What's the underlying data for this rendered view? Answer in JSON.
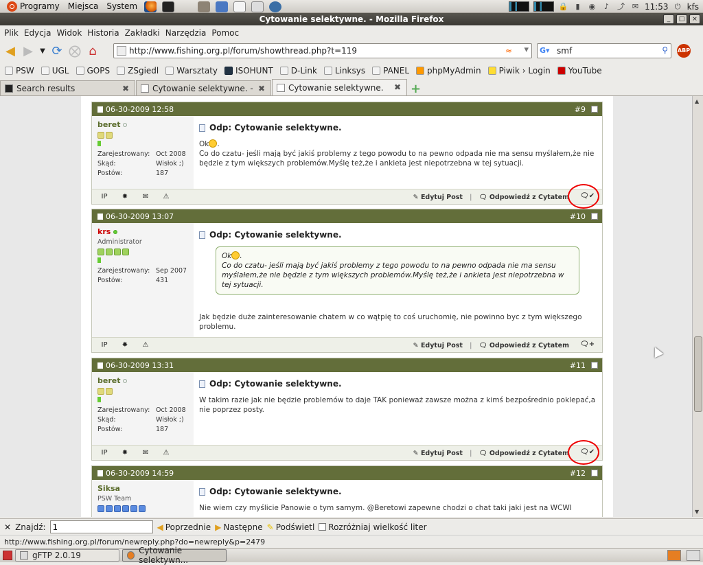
{
  "gnome_top": {
    "menus": [
      "Programy",
      "Miejsca",
      "System"
    ],
    "clock": "11:53",
    "user": "kfs"
  },
  "window": {
    "title": "Cytowanie selektywne. - Mozilla Firefox"
  },
  "menubar": [
    "Plik",
    "Edycja",
    "Widok",
    "Historia",
    "Zakładki",
    "Narzędzia",
    "Pomoc"
  ],
  "nav": {
    "url": "http://www.fishing.org.pl/forum/showthread.php?t=119",
    "search_value": "smf",
    "abp": "ABP"
  },
  "bookmarks": [
    "PSW",
    "UGL",
    "GOPS",
    "ZSgiedl",
    "Warsztaty",
    "ISOHUNT",
    "D-Link",
    "Linksys",
    "PANEL",
    "phpMyAdmin",
    "Piwik › Login",
    "YouTube"
  ],
  "tabs": [
    {
      "label": "Search results",
      "active": false
    },
    {
      "label": "Cytowanie selektywne. -",
      "active": false
    },
    {
      "label": "Cytowanie selektywne.",
      "active": true
    }
  ],
  "posts": [
    {
      "date": "06-30-2009 12:58",
      "num": "#9",
      "user": "beret",
      "rank": "",
      "registered_label": "Zarejestrowany:",
      "registered": "Oct 2008",
      "from_label": "Skąd:",
      "from": "Wisłok ;)",
      "posts_label": "Postów:",
      "posts": "187",
      "title": "Odp: Cytowanie selektywne.",
      "text_pre": "Ok",
      "text": ".\nCo do czatu- jeśli mają być jakiś problemy z tego powodu to na pewno odpada nie ma sensu myślałem,że nie będzie z tym większych problemów.Myślę też,że i ankieta jest niepotrzebna w tej sytuacji."
    },
    {
      "date": "06-30-2009 13:07",
      "num": "#10",
      "user": "krs",
      "rank": "Administrator",
      "registered_label": "Zarejestrowany:",
      "registered": "Sep 2007",
      "posts_label": "Postów:",
      "posts": "431",
      "title": "Odp: Cytowanie selektywne.",
      "quote_pre": "Ok",
      "quote": ".\nCo do czatu- jeśli mają być jakiś problemy z tego powodu to na pewno odpada nie ma sensu myślałem,że nie będzie z tym większych problemów.Myślę też,że i ankieta jest niepotrzebna w tej sytuacji.",
      "text": "Jak będzie duże zainteresowanie chatem w co wątpię to coś uruchomię, nie powinno byc z tym większego problemu."
    },
    {
      "date": "06-30-2009 13:31",
      "num": "#11",
      "user": "beret",
      "registered_label": "Zarejestrowany:",
      "registered": "Oct 2008",
      "from_label": "Skąd:",
      "from": "Wisłok ;)",
      "posts_label": "Postów:",
      "posts": "187",
      "title": "Odp: Cytowanie selektywne.",
      "text": "W takim razie jak nie będzie problemów to daje TAK ponieważ zawsze można z kimś bezpośrednio poklepać,a nie poprzez posty."
    },
    {
      "date": "06-30-2009 14:59",
      "num": "#12",
      "user": "Siksa",
      "rank": "PSW Team",
      "title": "Odp: Cytowanie selektywne.",
      "text": "Nie wiem czy myślicie Panowie o tym samym. @Beretowi zapewne chodzi o chat taki jaki jest na WCWI"
    }
  ],
  "post_actions": {
    "edit": "Edytuj Post",
    "reply_quote": "Odpowiedź z Cytatem"
  },
  "findbar": {
    "label": "Znajdź:",
    "value": "1",
    "prev": "Poprzednie",
    "next": "Następne",
    "highlight": "Podświetl",
    "match_case": "Rozróżniaj wielkość liter"
  },
  "status": "http://www.fishing.org.pl/forum/newreply.php?do=newreply&p=2479",
  "taskbar": [
    "gFTP 2.0.19",
    "Cytowanie selektywn..."
  ],
  "colors": {
    "post_header": "#636e3a",
    "admin": "#cc0000",
    "annotation": "#e00000"
  }
}
